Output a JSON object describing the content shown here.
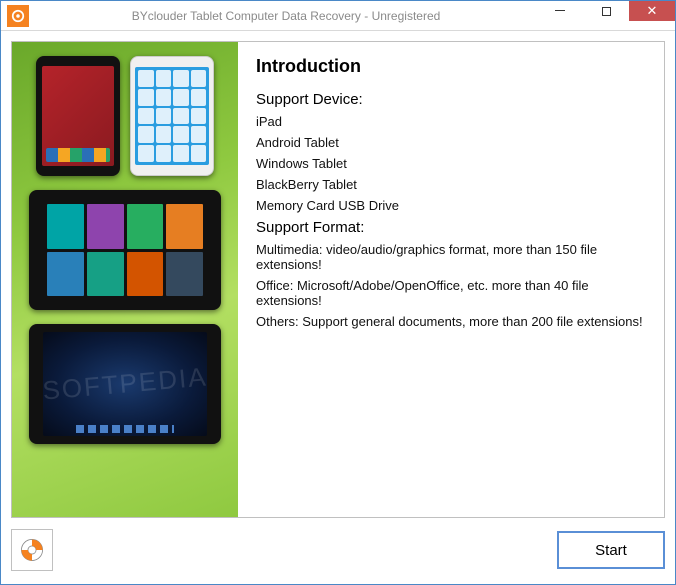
{
  "window": {
    "title": "BYclouder Tablet Computer Data Recovery - Unregistered"
  },
  "intro": {
    "heading": "Introduction",
    "devices_heading": "Support Device:",
    "devices": [
      "iPad",
      "Android Tablet",
      "Windows Tablet",
      "BlackBerry Tablet",
      "Memory Card USB Drive"
    ],
    "formats_heading": "Support Format:",
    "formats": [
      "Multimedia: video/audio/graphics format, more than 150 file extensions!",
      "Office: Microsoft/Adobe/OpenOffice, etc. more than 40 file extensions!",
      "Others: Support general documents, more than 200 file extensions!"
    ]
  },
  "watermark": "SOFTPEDIA",
  "buttons": {
    "start": "Start"
  },
  "icons": {
    "app": "app-icon",
    "help": "lifebuoy-icon",
    "minimize": "minimize-icon",
    "maximize": "maximize-icon",
    "close": "close-icon"
  }
}
